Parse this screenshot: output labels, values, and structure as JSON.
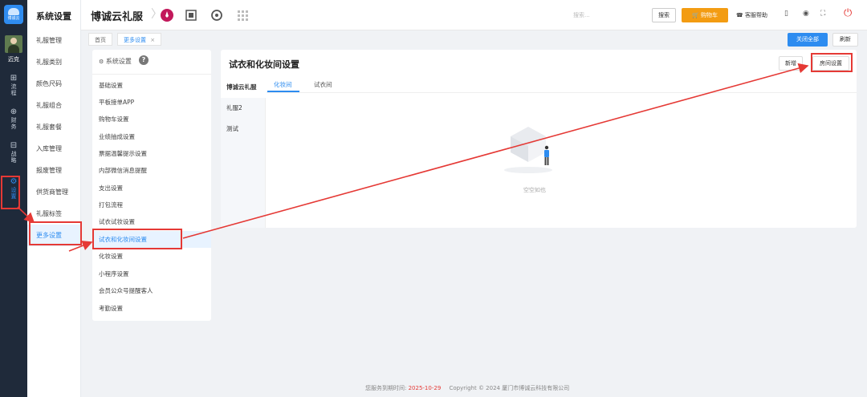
{
  "rail": {
    "logo": "博诚云",
    "user_name": "迈克",
    "items": [
      {
        "label": "流程",
        "icon": "grid-icon"
      },
      {
        "label": "财务",
        "icon": "wallet-icon"
      },
      {
        "label": "战略",
        "icon": "chart-icon"
      },
      {
        "label": "设置",
        "icon": "gear-icon"
      }
    ]
  },
  "sidebar": {
    "title": "系统设置",
    "items": [
      "礼服管理",
      "礼服类别",
      "颜色尺码",
      "礼服组合",
      "礼服套餐",
      "入库管理",
      "报废管理",
      "供货商管理",
      "礼服标签",
      "更多设置"
    ]
  },
  "header": {
    "brand": "博诚云礼服",
    "search_placeholder": "搜索...",
    "search_button": "搜索",
    "cart_button": "购物车",
    "help": "客服帮助"
  },
  "tabs": {
    "items": [
      "首页",
      "更多设置"
    ],
    "close_all": "关闭全部",
    "refresh": "刷新"
  },
  "settings_menu": {
    "title": "系统设置",
    "items": [
      "基础设置",
      "平板接单APP",
      "购物车设置",
      "业绩抽成设置",
      "票据温馨提示设置",
      "内部微信消息提醒",
      "支出设置",
      "打包流程",
      "试衣试妆设置",
      "试衣和化妆间设置",
      "化妆设置",
      "小程序设置",
      "会员公众号提醒客人",
      "考勤设置"
    ]
  },
  "main": {
    "title": "试衣和化妆间设置",
    "new_button": "新增",
    "room_button": "房间设置",
    "categories": [
      "博诚云礼服",
      "礼服2",
      "测试"
    ],
    "sub_tabs": [
      "化妆间",
      "试衣间"
    ],
    "empty_text": "空空如也"
  },
  "footer": {
    "expire_label": "您服务到期时间:",
    "expire_date": "2025-10-29",
    "copyright": "Copyright © 2024 厦门市博诚云科技有限公司"
  },
  "colors": {
    "accent": "#2d8cf0",
    "annotation": "#e53935",
    "cart": "#f39c12",
    "rail": "#1f2a3a"
  }
}
